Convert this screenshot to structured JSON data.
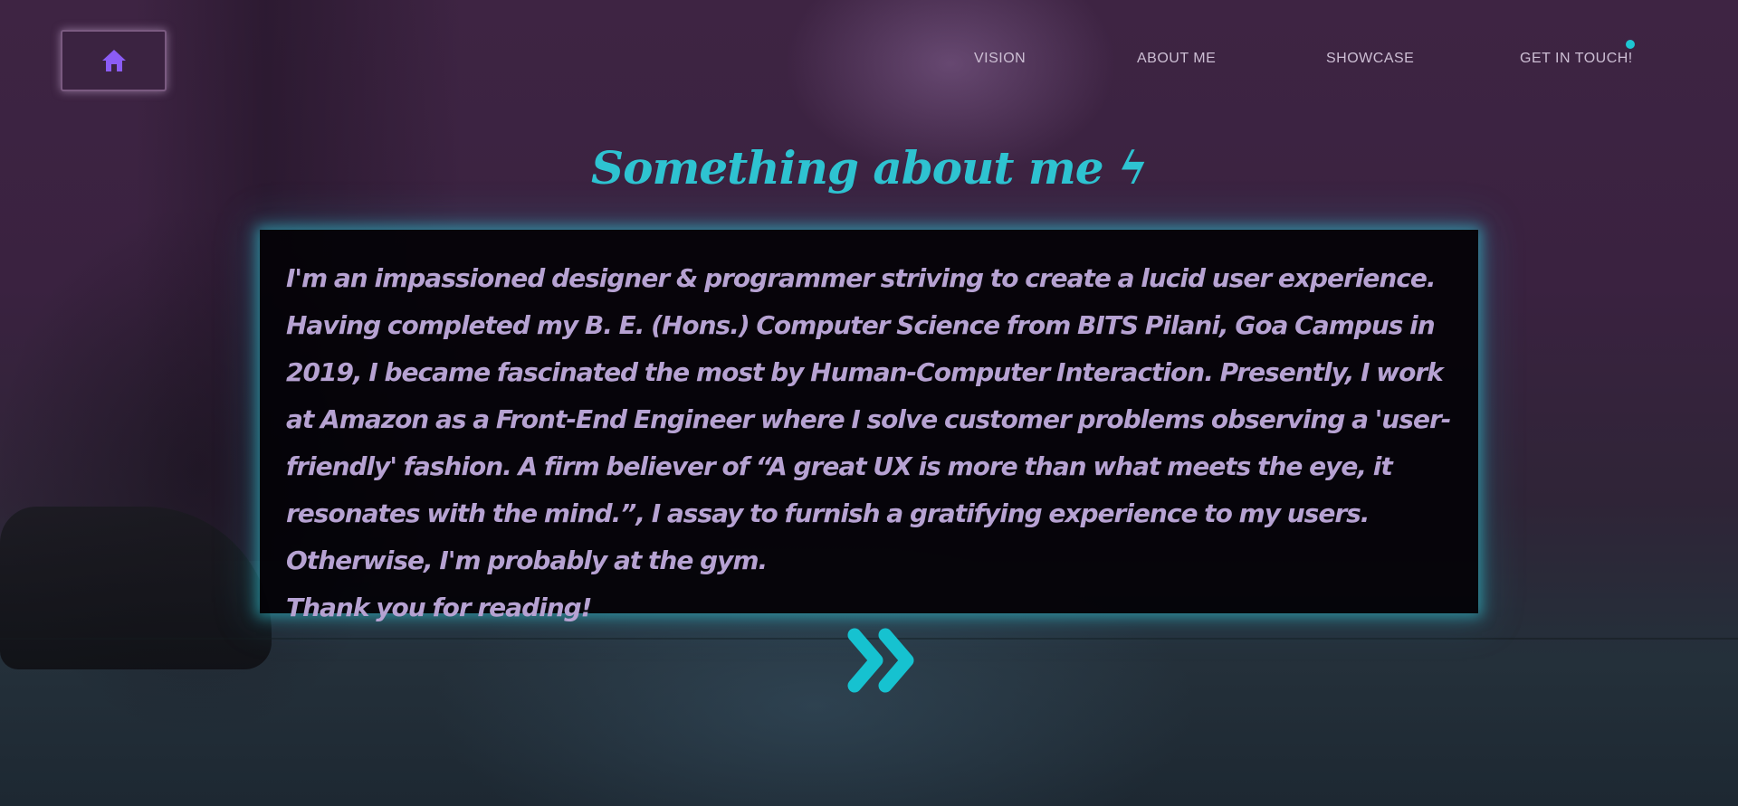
{
  "colors": {
    "accent": "#2ec3d1",
    "nav_text": "#cdbfd4",
    "body_text": "#b6a2d2",
    "home_icon": "#8b5cf6"
  },
  "home": {
    "icon": "home-icon"
  },
  "nav": {
    "items": [
      {
        "label": "VISION"
      },
      {
        "label": "ABOUT ME"
      },
      {
        "label": "SHOWCASE"
      },
      {
        "label": "GET IN TOUCH!"
      }
    ]
  },
  "about": {
    "heading": "Something about me ϟ",
    "paragraph": "I'm an impassioned designer & programmer striving to create a lucid user experience. Having completed my B. E. (Hons.) Computer Science from BITS Pilani, Goa Campus in 2019, I became fascinated the most by Human-Computer Interaction. Presently, I work at Amazon as a Front-End Engineer where I solve customer problems observing a 'user-friendly' fashion. A firm believer of “A great UX is more than what meets the eye, it resonates with the mind.”, I assay to furnish a gratifying experience to my users. Otherwise, I'm probably at the gym.",
    "closing": "Thank you for reading!"
  },
  "scroll": {
    "icon": "double-chevron-right-icon"
  }
}
